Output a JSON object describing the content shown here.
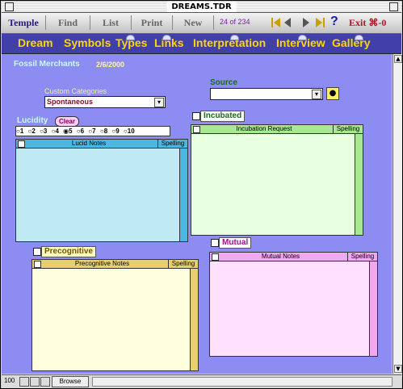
{
  "window": {
    "title": "DREAMS.TDR"
  },
  "toolbar": {
    "buttons": [
      "Temple",
      "Find",
      "List",
      "Print",
      "New"
    ],
    "record_counter": "24 of 234",
    "help": "?",
    "exit": "Exit ⌘-0"
  },
  "tabs": [
    "Dream",
    "Symbols",
    "Types",
    "Links",
    "Interpretation",
    "Interview",
    "Gallery"
  ],
  "record": {
    "title": "Fossil Merchants",
    "date": "2/6/2000"
  },
  "custom_categories": {
    "label": "Custom Categories",
    "value": "Spontaneous"
  },
  "source": {
    "label": "Source",
    "value": ""
  },
  "lucidity": {
    "label": "Lucidity",
    "clear_label": "Clear",
    "options": [
      "1",
      "2",
      "3",
      "4",
      "5",
      "6",
      "7",
      "8",
      "9",
      "10"
    ],
    "selected": "5"
  },
  "lucid_notes": {
    "title": "Lucid Notes",
    "spelling": "Spelling",
    "text": ""
  },
  "incubated": {
    "label": "Incubated",
    "checked": false
  },
  "incubation_request": {
    "title": "Incubation Request",
    "spelling": "Spelling",
    "text": ""
  },
  "precognitive": {
    "label": "Precognitive",
    "checked": false
  },
  "precognitive_notes": {
    "title": "Precognitive Notes",
    "spelling": "Spelling",
    "text": ""
  },
  "mutual": {
    "label": "Mutual",
    "checked": false
  },
  "mutual_notes": {
    "title": "Mutual Notes",
    "spelling": "Spelling",
    "text": ""
  },
  "status_bar": {
    "zoom": "100",
    "mode": "Browse"
  },
  "colors": {
    "background": "#8c8cf2",
    "tab_bar": "#4040a8",
    "tab_text": "#ffd700",
    "lucid_panel": "#bfeaf4",
    "incubation_panel": "#e8ffe0",
    "precog_panel": "#ffffe0",
    "mutual_panel": "#ffe0ff"
  }
}
